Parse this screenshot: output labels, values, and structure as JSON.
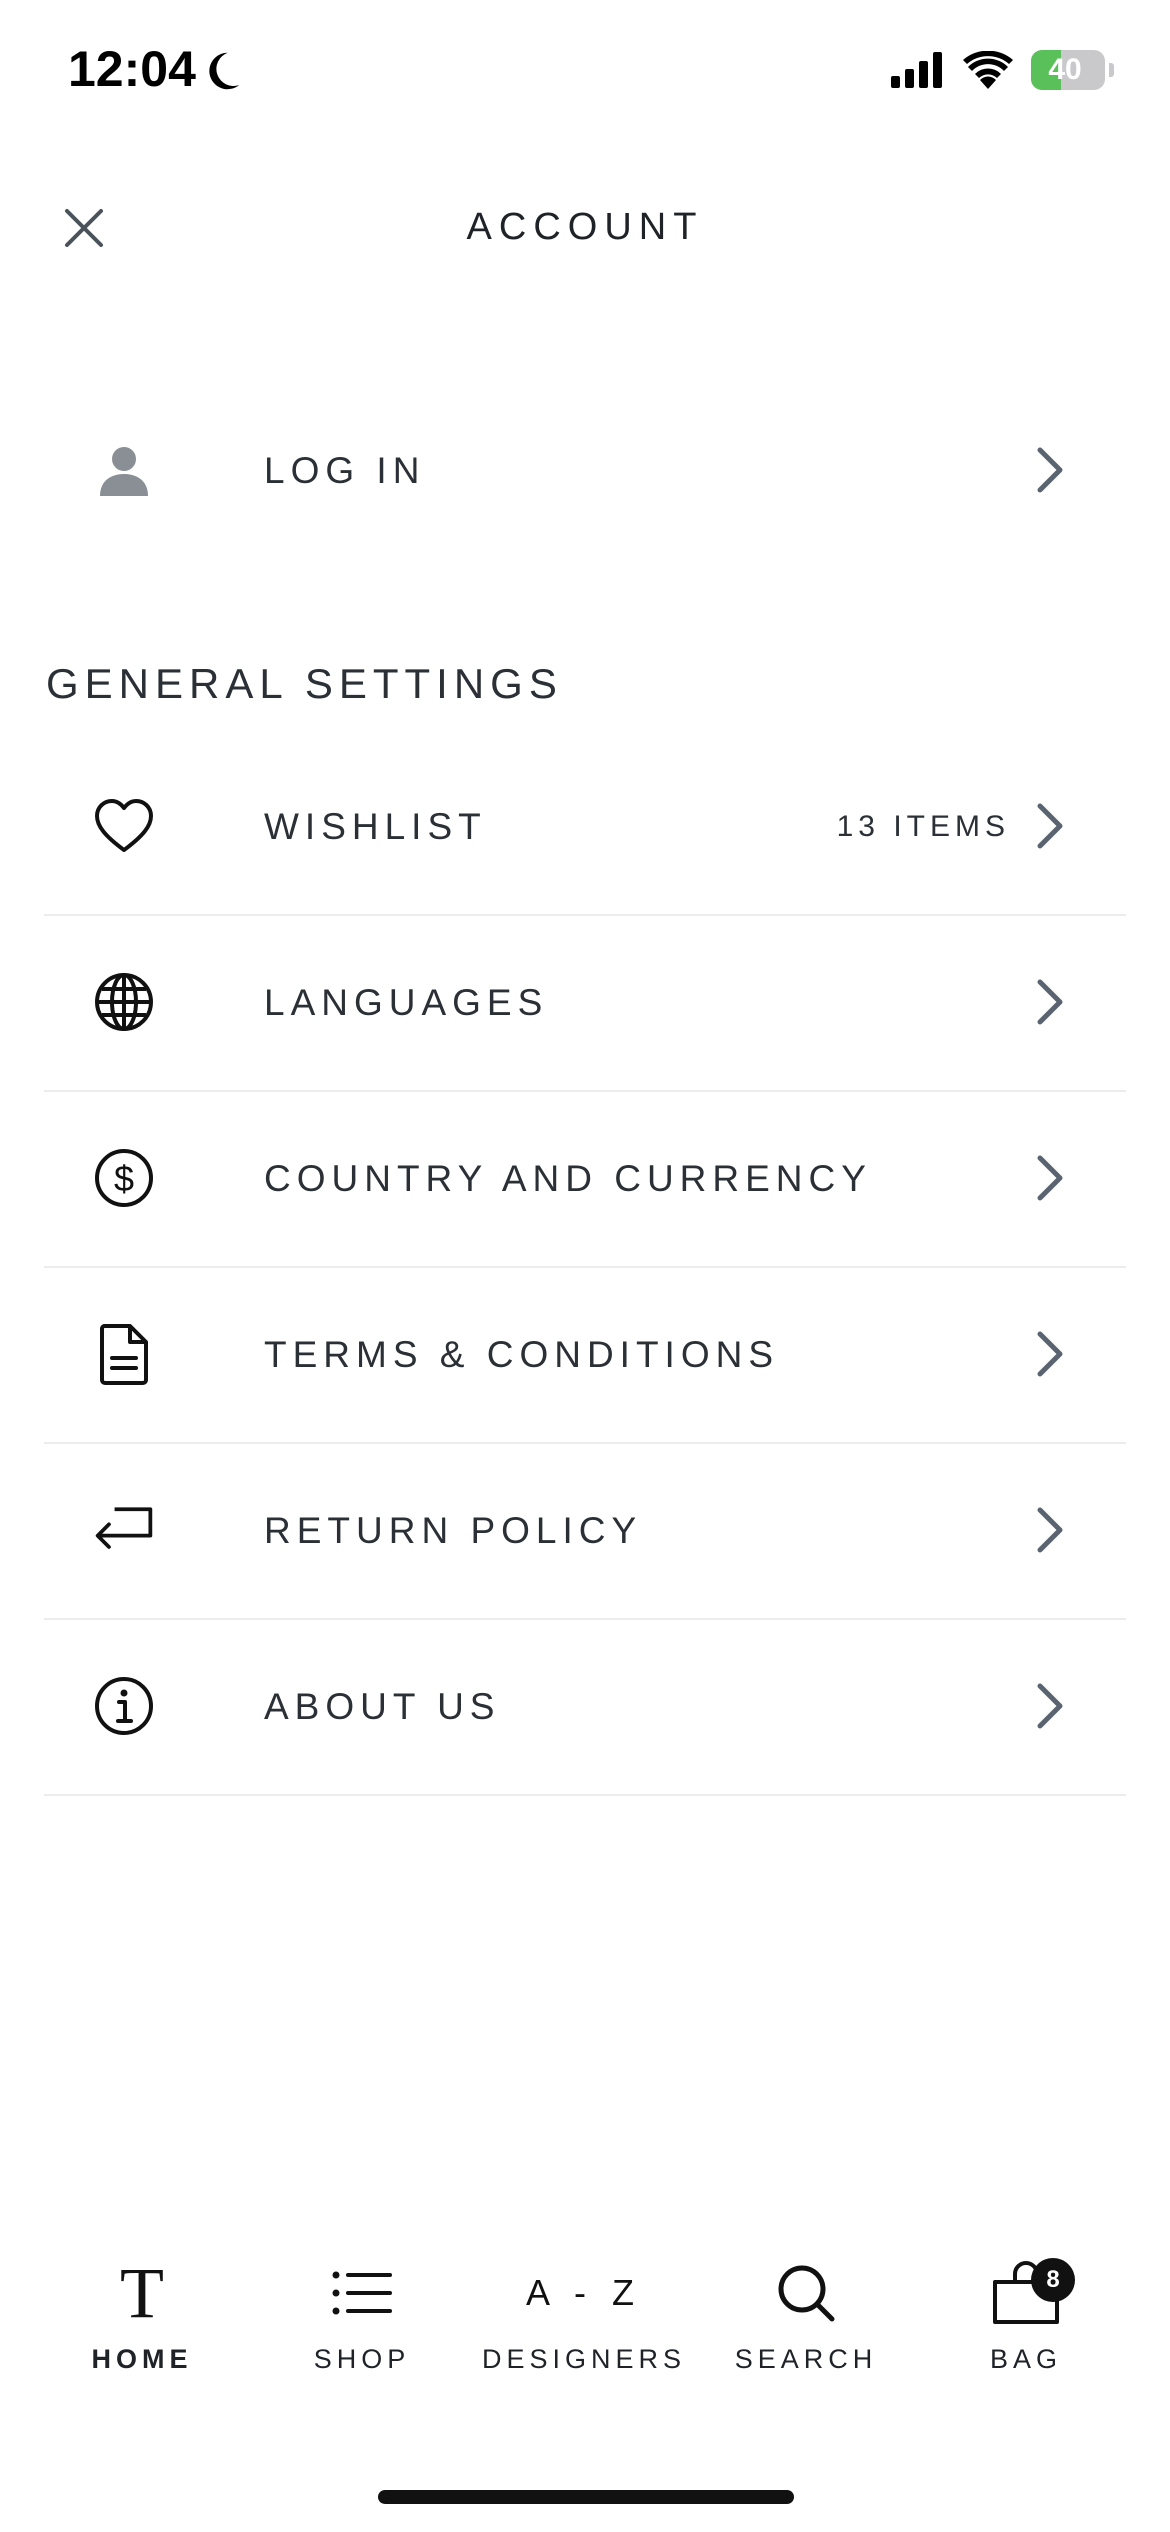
{
  "status_bar": {
    "time": "12:04",
    "battery_text": "40",
    "battery_level_percent": 40
  },
  "header": {
    "title": "ACCOUNT",
    "close_icon": "close-icon"
  },
  "login": {
    "label": "LOG IN",
    "icon": "person-icon"
  },
  "general_settings": {
    "title": "GENERAL SETTINGS",
    "items": [
      {
        "label": "WISHLIST",
        "value": "13 ITEMS",
        "icon": "heart-icon"
      },
      {
        "label": "LANGUAGES",
        "icon": "globe-icon"
      },
      {
        "label": "COUNTRY AND CURRENCY",
        "icon": "dollar-circle-icon"
      },
      {
        "label": "TERMS & CONDITIONS",
        "icon": "document-icon"
      },
      {
        "label": "RETURN POLICY",
        "icon": "return-arrow-icon"
      },
      {
        "label": "ABOUT US",
        "icon": "info-icon"
      }
    ]
  },
  "tab_bar": {
    "tabs": [
      {
        "label": "HOME",
        "glyph": "T",
        "active": true
      },
      {
        "label": "SHOP"
      },
      {
        "label": "DESIGNERS",
        "glyph": "A - Z"
      },
      {
        "label": "SEARCH"
      },
      {
        "label": "BAG",
        "badge": "8"
      }
    ]
  },
  "colors": {
    "background": "#ffffff",
    "text": "#1f2328",
    "chevron": "#5a6470",
    "divider": "#ececec",
    "battery_fill": "#5ac15a"
  }
}
